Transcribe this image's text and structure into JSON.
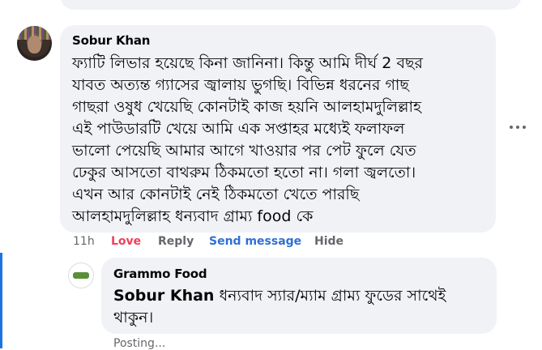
{
  "comment": {
    "author": "Sobur Khan",
    "lines": [
      "ফ্যাটি লিভার হয়েছে কিনা জানিনা। কিন্তু আমি দীর্ঘ 2 বছর",
      "যাবত অত্যন্ত গ্যাসের জ্বালায় ভুগছি। বিভিন্ন ধরনের গাছ",
      "গাছরা ওষুধ খেয়েছি কোনটাই কাজ হয়নি আলহামদুলিল্লাহ",
      "এই পাউডারটি খেয়ে আমি এক সপ্তাহর মধ্যেই ফলাফল",
      "ভালো পেয়েছি আমার আগে খাওয়ার পর পেট ফুলে যেত",
      "ঢেকুর আসতো বাথরুম ঠিকমতো হতো না। গলা জ্বলতো।",
      "এখন আর কোনটাই নেই ঠিকমতো খেতে পারছি",
      "আলহামদুলিল্লাহ ধন্যবাদ গ্রাম্য food কে"
    ],
    "time": "11h",
    "actions": {
      "love": "Love",
      "reply": "Reply",
      "send_message": "Send message",
      "hide": "Hide"
    },
    "more_icon": "more-horizontal-icon"
  },
  "reply": {
    "author": "Grammo Food",
    "mention": "Sobur Khan",
    "line1_rest": "ধন্যবাদ স্যার/ম্যাম গ্রাম্য ফুডের সাথেই",
    "line2": "থাকুন।",
    "status": "Posting..."
  },
  "colors": {
    "bubble": "#f0f2f5",
    "love": "#f33e58",
    "link": "#2f6fd6",
    "muted": "#65676b",
    "thread_line": "#1b74e4"
  }
}
